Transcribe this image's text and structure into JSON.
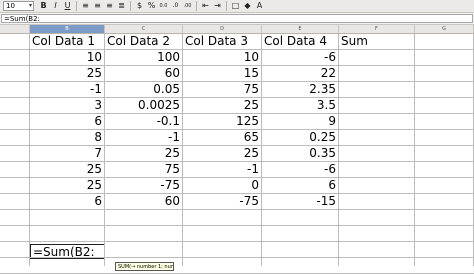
{
  "toolbar": {
    "font_size": "10",
    "items": [
      {
        "name": "bold-button",
        "glyph": "B",
        "bold": true
      },
      {
        "name": "italic-button",
        "glyph": "I",
        "italic": true
      },
      {
        "name": "underline-button",
        "glyph": "U",
        "underline": true
      },
      {
        "sep": true
      },
      {
        "name": "align-left-button",
        "glyph": "≡"
      },
      {
        "name": "align-center-button",
        "glyph": "≡"
      },
      {
        "name": "align-right-button",
        "glyph": "≡"
      },
      {
        "name": "justify-button",
        "glyph": "≣"
      },
      {
        "sep": true
      },
      {
        "name": "currency-format-button",
        "glyph": "$"
      },
      {
        "name": "percent-format-button",
        "glyph": "%"
      },
      {
        "name": "number-format-button",
        "glyph": "0.0"
      },
      {
        "name": "add-decimal-button",
        "glyph": ".0"
      },
      {
        "name": "remove-decimal-button",
        "glyph": ".00"
      },
      {
        "sep": true
      },
      {
        "name": "decrease-indent-button",
        "glyph": "⇤"
      },
      {
        "name": "increase-indent-button",
        "glyph": "⇥"
      },
      {
        "sep": true
      },
      {
        "name": "borders-button",
        "glyph": "□"
      },
      {
        "name": "background-color-button",
        "glyph": "◆"
      },
      {
        "name": "font-color-button",
        "glyph": "A"
      }
    ]
  },
  "formula_bar": {
    "value": "=Sum(B2:"
  },
  "columns": [
    {
      "letter": "A",
      "width": 30
    },
    {
      "letter": "B",
      "width": 75,
      "selected": true
    },
    {
      "letter": "C",
      "width": 78
    },
    {
      "letter": "D",
      "width": 79
    },
    {
      "letter": "E",
      "width": 77
    },
    {
      "letter": "F",
      "width": 76
    },
    {
      "letter": "G",
      "width": 59
    }
  ],
  "rows": [
    [
      "Col Data 1",
      "Col Data 2",
      "Col Data 3",
      "Col Data 4",
      "Sum"
    ],
    [
      "10",
      "100",
      "10",
      "-6",
      ""
    ],
    [
      "25",
      "60",
      "15",
      "22",
      ""
    ],
    [
      "-1",
      "0.05",
      "75",
      "2.35",
      ""
    ],
    [
      "3",
      "0.0025",
      "25",
      "3.5",
      ""
    ],
    [
      "6",
      "-0.1",
      "125",
      "9",
      ""
    ],
    [
      "8",
      "-1",
      "65",
      "0.25",
      ""
    ],
    [
      "7",
      "25",
      "25",
      "0.35",
      ""
    ],
    [
      "25",
      "75",
      "-1",
      "-6",
      ""
    ],
    [
      "25",
      "-75",
      "0",
      "6",
      ""
    ],
    [
      "6",
      "60",
      "-75",
      "-15",
      ""
    ]
  ],
  "active_cell": {
    "value": "=Sum(B2:"
  },
  "tooltip": "SUM(→ number 1; number 2; ... )"
}
